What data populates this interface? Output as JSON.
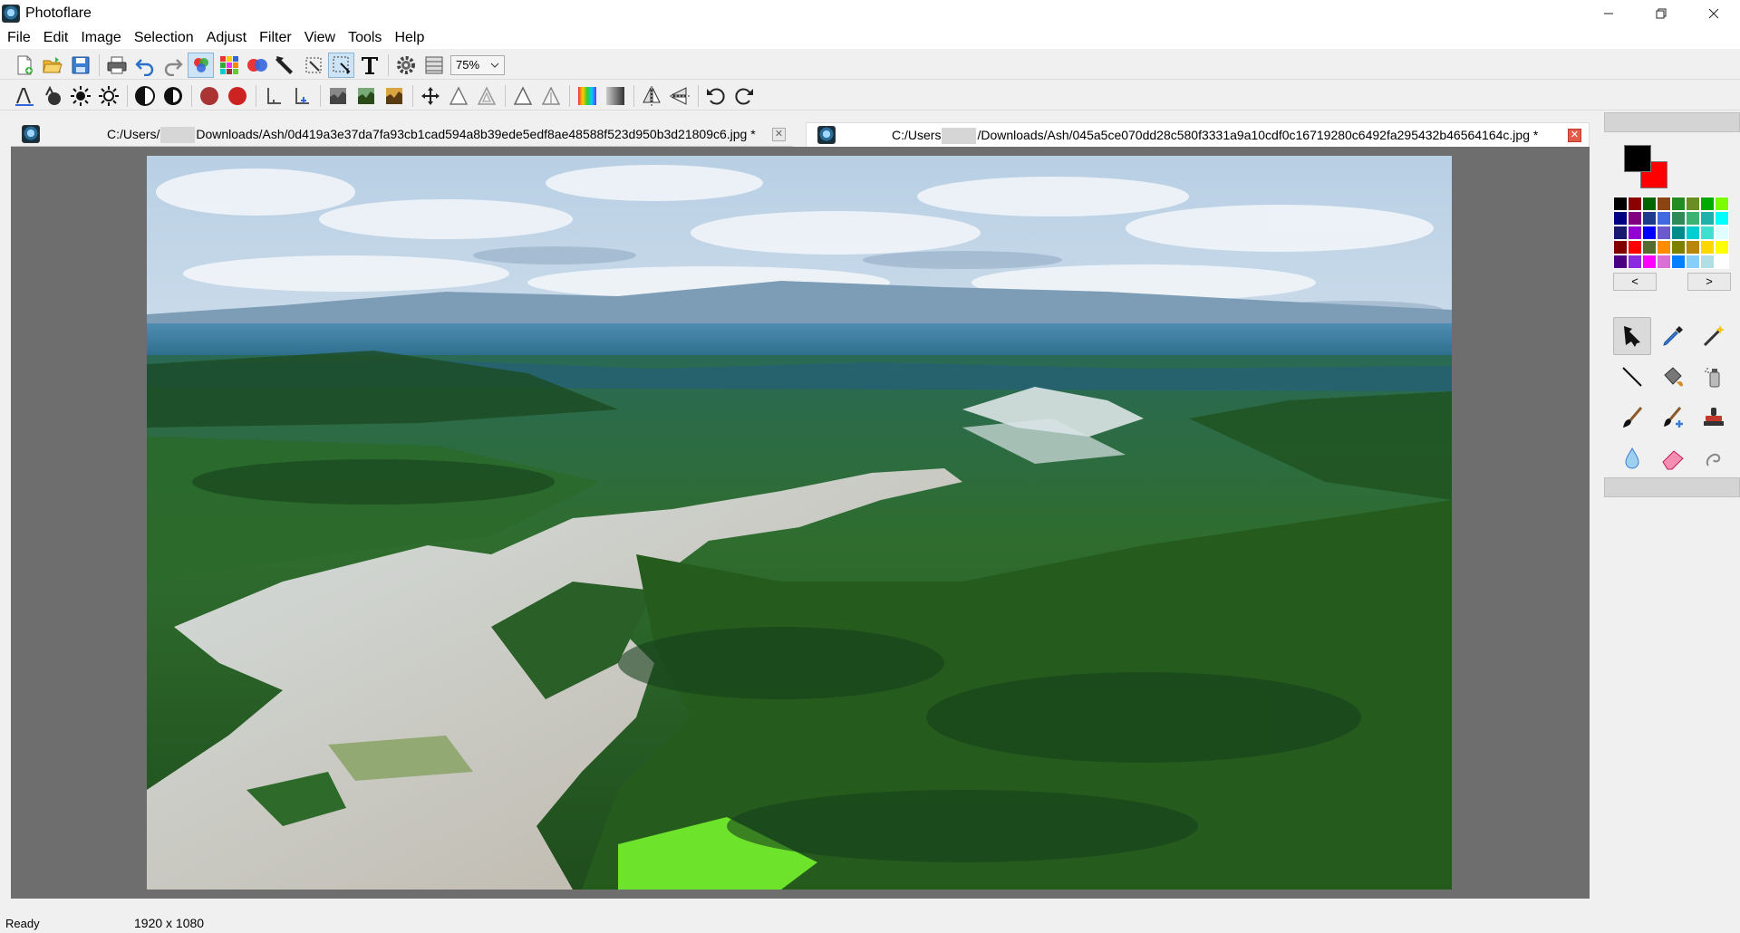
{
  "window": {
    "title": "Photoflare",
    "controls": [
      "minimize",
      "restore",
      "close"
    ]
  },
  "menubar": {
    "items": [
      "File",
      "Edit",
      "Image",
      "Selection",
      "Adjust",
      "Filter",
      "View",
      "Tools",
      "Help"
    ]
  },
  "toolbar_main": {
    "zoom_value": "75%"
  },
  "tabs": [
    {
      "path_prefix": "C:/Users/",
      "path_suffix": "Downloads/Ash/0d419a3e37da7fa93cb1cad594a8b39ede5edf8ae48588f523d950b3d21809c6.jpg *",
      "active": false
    },
    {
      "path_prefix": "C:/Users",
      "path_suffix": "/Downloads/Ash/045a5ce070dd28c580f3331a9a10cdf0c16719280c6492fa295432b46564164c.jpg *",
      "active": true
    }
  ],
  "colors": {
    "primary": "#000000",
    "secondary": "#ff0000",
    "palette": [
      "#000000",
      "#8b0000",
      "#006400",
      "#8b4513",
      "#228b22",
      "#6b8e23",
      "#00aa00",
      "#7cfc00",
      "#000080",
      "#800080",
      "#1e3a8a",
      "#4169e1",
      "#2e8b57",
      "#3cb371",
      "#20b2aa",
      "#00ffff",
      "#191970",
      "#9400d3",
      "#0000ff",
      "#6a5acd",
      "#008b8b",
      "#00ced1",
      "#40e0d0",
      "#e0ffff",
      "#800000",
      "#ff0000",
      "#556b2f",
      "#ff8c00",
      "#808000",
      "#b8860b",
      "#ffd700",
      "#ffff00",
      "#4b0082",
      "#8a2be2",
      "#ff00ff",
      "#da70d6",
      "#0080ff",
      "#87cefa",
      "#b0e0e6",
      "#ffffff"
    ]
  },
  "palette_nav": {
    "prev": "<",
    "next": ">"
  },
  "tools": [
    "pointer",
    "color-picker",
    "magic-wand",
    "line",
    "paint-bucket",
    "spray-can",
    "paint-brush",
    "brush-plus",
    "stamp",
    "blur-drop",
    "eraser",
    "smudge"
  ],
  "status": {
    "message": "Ready",
    "dimensions": "1920 x 1080"
  }
}
